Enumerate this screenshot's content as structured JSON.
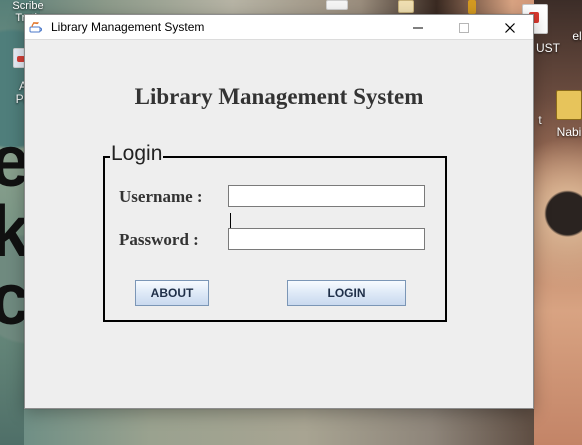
{
  "window": {
    "title": "Library Management System"
  },
  "heading": "Library Management System",
  "login_panel": {
    "legend": "Login",
    "username_label": "Username :",
    "password_label": "Password  :",
    "username_value": "",
    "password_value": "",
    "about_label": "ABOUT",
    "login_label": "LOGIN"
  },
  "desktop": {
    "left_icon_label": "A\nPa",
    "top_text": "Scribe Truth",
    "right_labels": [
      "UST",
      "el",
      "t",
      "Nabi"
    ]
  },
  "icons": {
    "app": "java-icon",
    "minimize": "minimize-icon",
    "maximize": "maximize-icon",
    "close": "close-icon"
  },
  "colors": {
    "window_bg": "#eeeeee",
    "titlebar_bg": "#ffffff",
    "button_border": "#7b96b6",
    "panel_border": "#000000"
  }
}
